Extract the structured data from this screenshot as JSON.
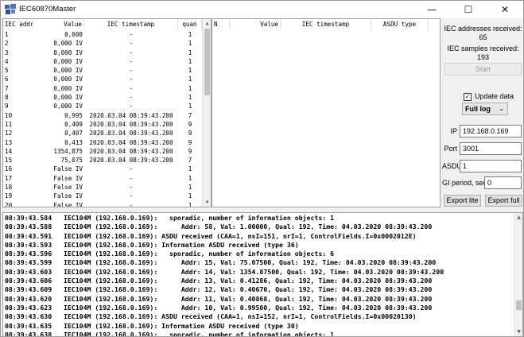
{
  "window": {
    "title": "IEC60870Master"
  },
  "titlebar": {
    "min": "—",
    "max": "☐",
    "close": "✕"
  },
  "grid1": {
    "headers": [
      "IEC addr",
      "Value",
      "IEC timestamp",
      "quan"
    ],
    "rows": [
      [
        "1",
        "0,000",
        "-",
        "1"
      ],
      [
        "2",
        "0,000 IV",
        "-",
        "1"
      ],
      [
        "3",
        "0,000 IV",
        "-",
        "1"
      ],
      [
        "4",
        "0,000 IV",
        "-",
        "1"
      ],
      [
        "5",
        "0,000 IV",
        "-",
        "1"
      ],
      [
        "6",
        "0,000 IV",
        "-",
        "1"
      ],
      [
        "7",
        "0,000 IV",
        "-",
        "1"
      ],
      [
        "8",
        "0,000 IV",
        "-",
        "1"
      ],
      [
        "9",
        "0,000 IV",
        "-",
        "1"
      ],
      [
        "10",
        "0,995",
        "2020.03.04 08:39:43.200",
        "7"
      ],
      [
        "11",
        "0,409",
        "2020.03.04 08:39:43.200",
        "9"
      ],
      [
        "12",
        "0,407",
        "2020.03.04 08:39:43.200",
        "9"
      ],
      [
        "13",
        "0,413",
        "2020.03.04 08:39:43.200",
        "9"
      ],
      [
        "14",
        "1354,875",
        "2020.03.04 08:39:43.200",
        "9"
      ],
      [
        "15",
        "75,075",
        "2020.03.04 08:39:43.200",
        "7"
      ],
      [
        "16",
        "False IV",
        "-",
        "1"
      ],
      [
        "17",
        "False IV",
        "-",
        "1"
      ],
      [
        "18",
        "False IV",
        "-",
        "1"
      ],
      [
        "19",
        "False IV",
        "-",
        "1"
      ],
      [
        "20",
        "False IV",
        "-",
        "1"
      ]
    ]
  },
  "grid2": {
    "headers": [
      "N",
      "Value",
      "IEC timestamp",
      "ASDU type"
    ]
  },
  "panel": {
    "addr_label": "IEC addresses received:",
    "addr_value": "65",
    "samples_label": "IEC samples received:",
    "samples_value": "193",
    "start_label": "Start",
    "update_label": "Update data",
    "update_checked": true,
    "log_mode": "Full log",
    "ip_label": "IP",
    "ip_value": "192.168.0.169",
    "port_label": "Port",
    "port_value": "3001",
    "asdu_label": "ASDU",
    "asdu_value": "1",
    "gi_label": "GI period, sec",
    "gi_value": "0",
    "export_lite": "Export lite",
    "export_full": "Export full"
  },
  "log": {
    "lines": [
      "08:39:43.584   IEC104M (192.168.0.169):   sporadic, number of information objects: 1",
      "08:39:43.588   IEC104M (192.168.0.169):      Addr: 58, Val: 1.00000, Qual: 192, Time: 04.03.2020 08:39:43.200",
      "08:39:43.591   IEC104M (192.168.0.169): ASDU received (CAA=1, nsI=151, nrI=1, ControlFields.I=0x0002012E)",
      "08:39:43.593   IEC104M (192.168.0.169): Information ASDU received (type 36)",
      "08:39:43.596   IEC104M (192.168.0.169):   sporadic, number of information objects: 6",
      "08:39:43.599   IEC104M (192.168.0.169):      Addr: 15, Val: 75.07500, Qual: 192, Time: 04.03.2020 08:39:43.200",
      "08:39:43.603   IEC104M (192.168.0.169):      Addr: 14, Val: 1354.87500, Qual: 192, Time: 04.03.2020 08:39:43.200",
      "08:39:43.606   IEC104M (192.168.0.169):      Addr: 13, Val: 0.41286, Qual: 192, Time: 04.03.2020 08:39:43.200",
      "08:39:43.609   IEC104M (192.168.0.169):      Addr: 12, Val: 0.40670, Qual: 192, Time: 04.03.2020 08:39:43.200",
      "08:39:43.620   IEC104M (192.168.0.169):      Addr: 11, Val: 0.40868, Qual: 192, Time: 04.03.2020 08:39:43.200",
      "08:39:43.623   IEC104M (192.168.0.169):      Addr: 10, Val: 0.99500, Qual: 192, Time: 04.03.2020 08:39:43.200",
      "08:39:43.630   IEC104M (192.168.0.169): ASDU received (CAA=1, nsI=152, nrI=1, ControlFields.I=0x00020130)",
      "08:39:43.635   IEC104M (192.168.0.169): Information ASDU received (type 30)",
      "08:39:43.638   IEC104M (192.168.0.169):   sporadic, number of information objects: 1"
    ]
  },
  "icons": {
    "app": "app-icon",
    "scroll_up": "up-arrow-icon",
    "scroll_down": "down-arrow-icon"
  }
}
